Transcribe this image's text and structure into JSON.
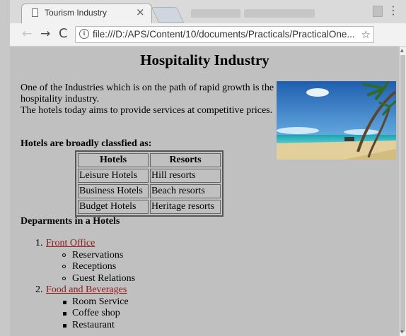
{
  "browser": {
    "tab_title": "Tourism Industry",
    "close_glyph": "×",
    "url": "file:///D:/APS/Content/10/documents/Practicals/PracticalOne...",
    "back_glyph": "←",
    "forward_glyph": "→",
    "reload_glyph": "C",
    "info_glyph": "i",
    "star_glyph": "☆",
    "menu_glyph": "⋮"
  },
  "page": {
    "heading": "Hospitality Industry",
    "intro_line1": "One of the Industries which is on the path of rapid growth is the hospitality industry.",
    "intro_line2": "The hotels today aims to provide services at competitive prices.",
    "image_icon": "beach-photo",
    "hotels_heading": "Hotels are broadly classfied as:",
    "table": {
      "headers": [
        "Hotels",
        "Resorts"
      ],
      "rows": [
        [
          "Leisure Hotels",
          "Hill resorts"
        ],
        [
          "Business Hotels",
          "Beach resorts"
        ],
        [
          "Budget Hotels",
          "Heritage resorts"
        ]
      ]
    },
    "departments_heading": "Deparments in a Hotels",
    "departments": [
      {
        "number": "1.",
        "name": "Front Office",
        "items": [
          "Reservations",
          "Receptions",
          "Guest Relations"
        ]
      },
      {
        "number": "2.",
        "name": "Food and Beverages",
        "items": [
          "Room Service",
          "Coffee shop",
          "Restaurant"
        ]
      }
    ]
  },
  "colors": {
    "page_background": "#c0c0c0",
    "link": "#8b1a1a"
  }
}
